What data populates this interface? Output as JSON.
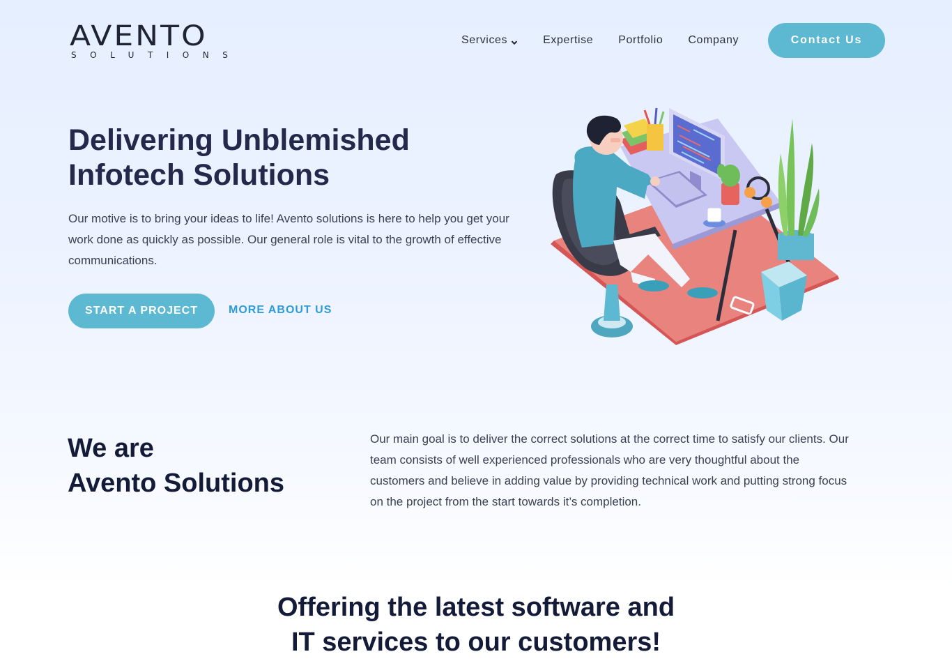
{
  "logo": {
    "main": "AVENTO",
    "sub": "SOLUTIONS"
  },
  "nav": {
    "items": [
      {
        "label": "Services",
        "has_dropdown": true,
        "icon": "chevron-down-icon"
      },
      {
        "label": "Expertise"
      },
      {
        "label": "Portfolio"
      },
      {
        "label": "Company"
      }
    ],
    "contact_label": "Contact Us"
  },
  "hero": {
    "title_line1": "Delivering Unblemished",
    "title_line2": "Infotech Solutions",
    "description": "Our motive is to bring your ideas to life! Avento solutions is here to help you get your work done as quickly as possible. Our general role is vital to the growth of effective communications.",
    "primary_button": "START A PROJECT",
    "secondary_button": "MORE ABOUT US"
  },
  "about": {
    "title_line1": "We are",
    "title_line2": "Avento Solutions",
    "text": "Our main goal is to deliver the correct solutions at the correct time to satisfy our clients.  Our team consists of well experienced professionals who are very thoughtful about the customers and believe in adding value by providing technical work and putting strong focus on the project from the start towards it’s completion."
  },
  "offer": {
    "title_line1": "Offering the latest software and",
    "title_line2": "IT services to our customers!"
  },
  "colors": {
    "accent": "#5db9d2",
    "link": "#2e9bd9",
    "heading": "#22294a",
    "background": "#e6efff"
  }
}
